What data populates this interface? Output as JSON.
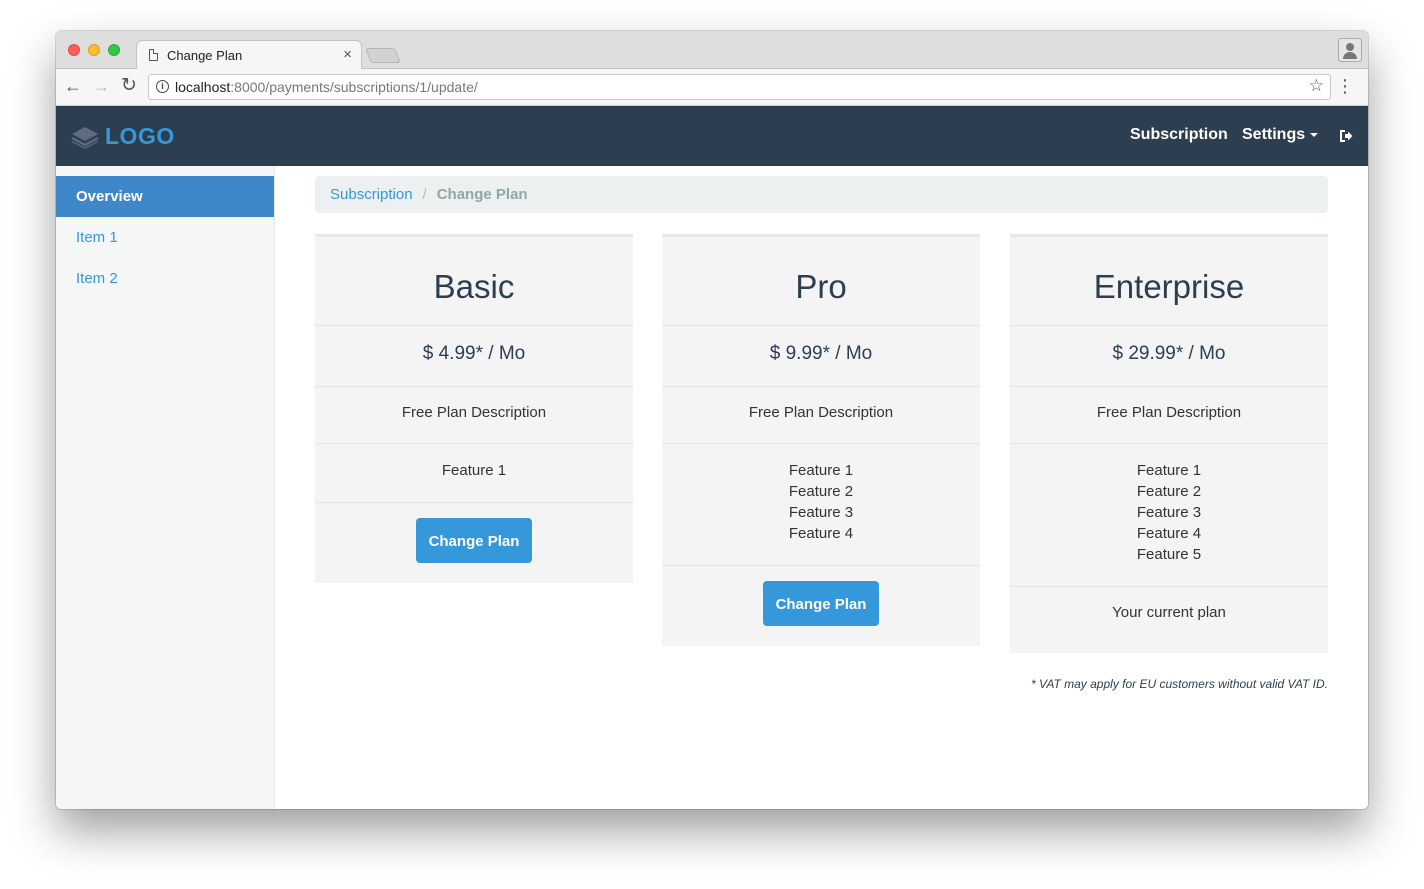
{
  "browser": {
    "tab_title": "Change Plan",
    "tab_close": "×",
    "url_host": "localhost",
    "url_path": ":8000/payments/subscriptions/1/update/",
    "back_glyph": "←",
    "forward_glyph": "→",
    "reload_glyph": "↻",
    "star_glyph": "☆",
    "menu_glyph": "⋮",
    "info_glyph": "i"
  },
  "navbar": {
    "logo": "LOGO",
    "subscription": "Subscription",
    "settings": "Settings"
  },
  "sidebar": {
    "items": [
      {
        "label": "Overview"
      },
      {
        "label": "Item 1"
      },
      {
        "label": "Item 2"
      }
    ]
  },
  "breadcrumb": {
    "link": "Subscription",
    "separator": "/",
    "current": "Change Plan"
  },
  "plans": [
    {
      "name": "Basic",
      "price": "$ 4.99* / Mo",
      "description": "Free Plan Description",
      "features": [
        "Feature 1"
      ],
      "action": "Change Plan"
    },
    {
      "name": "Pro",
      "price": "$ 9.99* / Mo",
      "description": "Free Plan Description",
      "features": [
        "Feature 1",
        "Feature 2",
        "Feature 3",
        "Feature 4"
      ],
      "action": "Change Plan"
    },
    {
      "name": "Enterprise",
      "price": "$ 29.99* / Mo",
      "description": "Free Plan Description",
      "features": [
        "Feature 1",
        "Feature 2",
        "Feature 3",
        "Feature 4",
        "Feature 5"
      ],
      "current_text": "Your current plan"
    }
  ],
  "footnote": "* VAT may apply for EU customers without valid VAT ID.",
  "colors": {
    "navbar": "#2c3e50",
    "accent": "#3498db",
    "sidebar_active": "#3e87c9"
  }
}
